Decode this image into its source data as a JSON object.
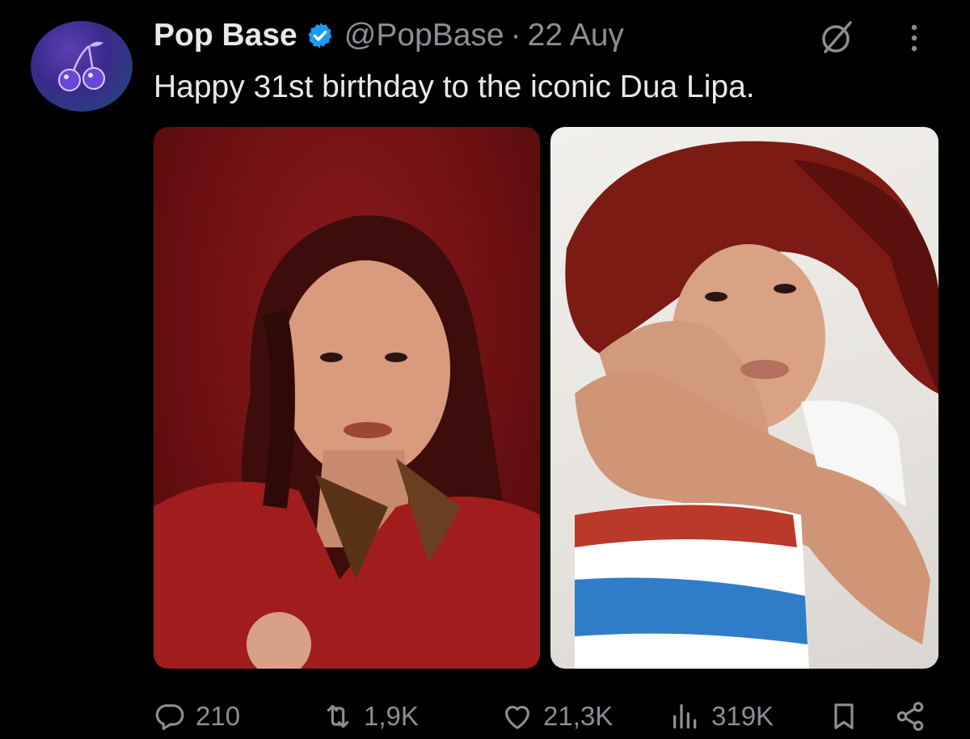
{
  "tweet": {
    "author_name": "Pop Base",
    "handle": "@PopBase",
    "separator": "·",
    "date": "22 Auγ",
    "text": "Happy 31st birthday to the iconic Dua Lipa.",
    "verified": true
  },
  "icons": {
    "avatar": "cherry-icon",
    "verified": "verified-badge-icon",
    "grok": "grok-icon",
    "more": "more-vertical-icon",
    "reply": "reply-icon",
    "retweet": "retweet-icon",
    "like": "heart-icon",
    "views": "views-icon",
    "bookmark": "bookmark-icon",
    "share": "share-icon"
  },
  "stats": {
    "replies": "210",
    "retweets": "1,9K",
    "likes": "21,3K",
    "views": "319K"
  },
  "colors": {
    "background": "#000000",
    "primary_text": "#e7e9ea",
    "secondary_text": "#8b8f94",
    "verified_blue": "#1d9bf0",
    "avatar_purple": "#5a3fb0"
  }
}
